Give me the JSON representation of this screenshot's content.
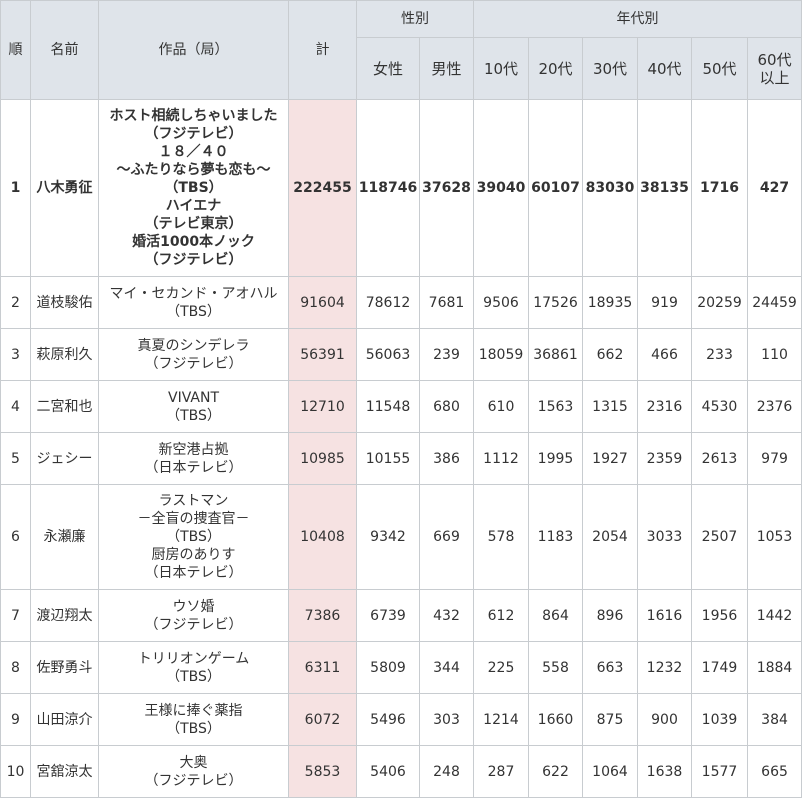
{
  "headers": {
    "rank": "順",
    "name": "名前",
    "work": "作品（局）",
    "total": "計",
    "gender_group": "性別",
    "age_group": "年代別",
    "female": "女性",
    "male": "男性",
    "age10": "10代",
    "age20": "20代",
    "age30": "30代",
    "age40": "40代",
    "age50": "50代",
    "age60_line1": "60代",
    "age60_line2": "以上"
  },
  "rows": [
    {
      "rank": "1",
      "name": "八木勇征",
      "works": [
        "ホスト相続しちゃいました",
        "（フジテレビ）",
        "１８／４０",
        "～ふたりなら夢も恋も～",
        "（TBS）",
        "ハイエナ",
        "（テレビ東京）",
        "婚活1000本ノック",
        "（フジテレビ）"
      ],
      "total": "222455",
      "female": "118746",
      "male": "37628",
      "age10": "39040",
      "age20": "60107",
      "age30": "83030",
      "age40": "38135",
      "age50": "1716",
      "age60": "427"
    },
    {
      "rank": "2",
      "name": "道枝駿佑",
      "works": [
        "マイ・セカンド・アオハル",
        "（TBS）"
      ],
      "total": "91604",
      "female": "78612",
      "male": "7681",
      "age10": "9506",
      "age20": "17526",
      "age30": "18935",
      "age40": "919",
      "age50": "20259",
      "age60": "24459"
    },
    {
      "rank": "3",
      "name": "萩原利久",
      "works": [
        "真夏のシンデレラ",
        "（フジテレビ）"
      ],
      "total": "56391",
      "female": "56063",
      "male": "239",
      "age10": "18059",
      "age20": "36861",
      "age30": "662",
      "age40": "466",
      "age50": "233",
      "age60": "110"
    },
    {
      "rank": "4",
      "name": "二宮和也",
      "works": [
        "VIVANT",
        "（TBS）"
      ],
      "total": "12710",
      "female": "11548",
      "male": "680",
      "age10": "610",
      "age20": "1563",
      "age30": "1315",
      "age40": "2316",
      "age50": "4530",
      "age60": "2376"
    },
    {
      "rank": "5",
      "name": "ジェシー",
      "works": [
        "新空港占拠",
        "（日本テレビ）"
      ],
      "total": "10985",
      "female": "10155",
      "male": "386",
      "age10": "1112",
      "age20": "1995",
      "age30": "1927",
      "age40": "2359",
      "age50": "2613",
      "age60": "979"
    },
    {
      "rank": "6",
      "name": "永瀬廉",
      "works": [
        "ラストマン",
        "－全盲の捜査官－",
        "（TBS）",
        "厨房のありす",
        "（日本テレビ）"
      ],
      "total": "10408",
      "female": "9342",
      "male": "669",
      "age10": "578",
      "age20": "1183",
      "age30": "2054",
      "age40": "3033",
      "age50": "2507",
      "age60": "1053"
    },
    {
      "rank": "7",
      "name": "渡辺翔太",
      "works": [
        "ウソ婚",
        "（フジテレビ）"
      ],
      "total": "7386",
      "female": "6739",
      "male": "432",
      "age10": "612",
      "age20": "864",
      "age30": "896",
      "age40": "1616",
      "age50": "1956",
      "age60": "1442"
    },
    {
      "rank": "8",
      "name": "佐野勇斗",
      "works": [
        "トリリオンゲーム",
        "（TBS）"
      ],
      "total": "6311",
      "female": "5809",
      "male": "344",
      "age10": "225",
      "age20": "558",
      "age30": "663",
      "age40": "1232",
      "age50": "1749",
      "age60": "1884"
    },
    {
      "rank": "9",
      "name": "山田涼介",
      "works": [
        "王様に捧ぐ薬指",
        "（TBS）"
      ],
      "total": "6072",
      "female": "5496",
      "male": "303",
      "age10": "1214",
      "age20": "1660",
      "age30": "875",
      "age40": "900",
      "age50": "1039",
      "age60": "384"
    },
    {
      "rank": "10",
      "name": "宮舘涼太",
      "works": [
        "大奥",
        "（フジテレビ）"
      ],
      "total": "5853",
      "female": "5406",
      "male": "248",
      "age10": "287",
      "age20": "622",
      "age30": "1064",
      "age40": "1638",
      "age50": "1577",
      "age60": "665"
    }
  ]
}
